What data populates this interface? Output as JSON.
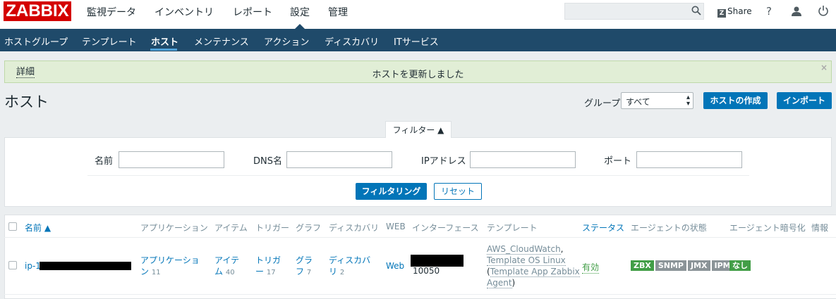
{
  "logo": "ZABBIX",
  "main_menu": [
    "監視データ",
    "インベントリ",
    "レポート",
    "設定",
    "管理"
  ],
  "share_label": "Share",
  "help_label": "?",
  "sub_menu": [
    "ホストグループ",
    "テンプレート",
    "ホスト",
    "メンテナンス",
    "アクション",
    "ディスカバリ",
    "ITサービス"
  ],
  "message": {
    "details": "詳細",
    "text": "ホストを更新しました",
    "close": "×"
  },
  "page_title": "ホスト",
  "group": {
    "label": "グループ",
    "value": "すべて"
  },
  "buttons": {
    "create": "ホストの作成",
    "import": "インポート"
  },
  "filter": {
    "tab": "フィルター ▲",
    "name_label": "名前",
    "dns_label": "DNS名",
    "ip_label": "IPアドレス",
    "port_label": "ポート",
    "apply": "フィルタリング",
    "reset": "リセット"
  },
  "table": {
    "headers": [
      "名前 ▲",
      "アプリケーション",
      "アイテム",
      "トリガー",
      "グラフ",
      "ディスカバリ",
      "WEB",
      "インターフェース",
      "テンプレート",
      "ステータス",
      "エージェントの状態",
      "エージェント暗号化",
      "情報"
    ],
    "row": {
      "name": "ip-1",
      "app_label_1": "アプリケーショ",
      "app_label_2": "ン",
      "app_count": "11",
      "items_label_1": "アイテ",
      "items_label_2": "ム",
      "items_count": "40",
      "triggers_label_1": "トリガ",
      "triggers_label_2": "ー",
      "triggers_count": "17",
      "graphs_label_1": "グラ",
      "graphs_label_2": "フ",
      "graphs_count": "7",
      "discovery_label_1": "ディスカバ",
      "discovery_label_2": "リ",
      "discovery_count": "2",
      "web": "Web",
      "interface_port": "10050",
      "template_1": "AWS_CloudWatch",
      "template_2": "Template OS Linux",
      "template_3": "Template App Zabbix",
      "template_4": "Agent",
      "status": "有効",
      "agents": [
        "ZBX",
        "SNMP",
        "JMX",
        "IPMI"
      ],
      "encryption": "なし"
    }
  },
  "colors": {
    "logo": "#d40000",
    "nav": "#1f4a6a",
    "link": "#0275b8",
    "success": "#429e47",
    "agent_grey": "#8b9498"
  }
}
